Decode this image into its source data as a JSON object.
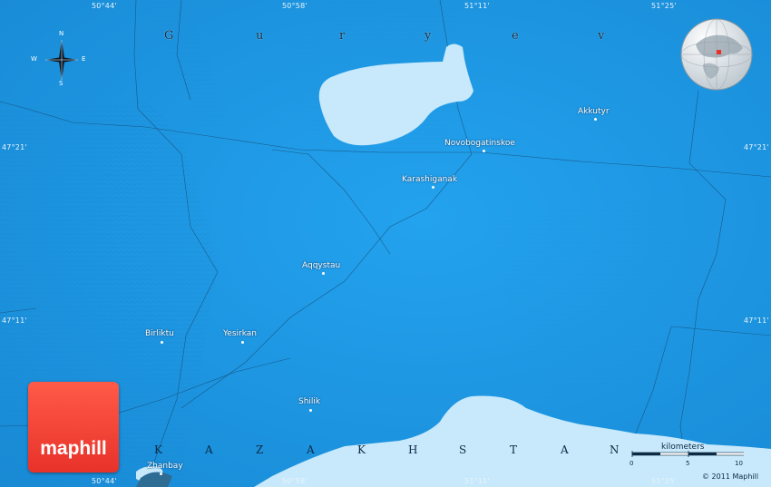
{
  "map": {
    "water_color": "#1e9ae6",
    "lake_color": "#c7e9fb",
    "top_ticks": [
      "50°44'",
      "50°58'",
      "51°11'",
      "51°25'"
    ],
    "bottom_ticks": [
      "50°44'",
      "50°58'",
      "51°11'",
      "51°25'"
    ],
    "left_ticks": [
      "47°21'",
      "47°11'"
    ],
    "right_ticks": [
      "47°21'",
      "47°11'"
    ],
    "region_letters": [
      "G",
      "u",
      "r",
      "y",
      "e",
      "v"
    ],
    "country_letters": [
      "K",
      "A",
      "Z",
      "A",
      "K",
      "H",
      "S",
      "T",
      "A",
      "N"
    ],
    "places": [
      {
        "name": "Akkutyr",
        "id": "akkutyr"
      },
      {
        "name": "Novobogatinskoe",
        "id": "novobogatinskoe"
      },
      {
        "name": "Karashiganak",
        "id": "karashiganak"
      },
      {
        "name": "Aqqystau",
        "id": "aqqystau"
      },
      {
        "name": "Birliktu",
        "id": "birliktu"
      },
      {
        "name": "Yesirkan",
        "id": "yesirkan"
      },
      {
        "name": "Shilik",
        "id": "shilik"
      },
      {
        "name": "Zhanbay",
        "id": "zhanbay"
      }
    ],
    "compass": {
      "n": "N",
      "s": "S",
      "e": "E",
      "w": "W"
    },
    "logo_text": "maphill",
    "scale": {
      "title": "kilometers",
      "labels": [
        "0",
        "5",
        "10"
      ]
    },
    "copyright": "© 2011 Maphill"
  }
}
